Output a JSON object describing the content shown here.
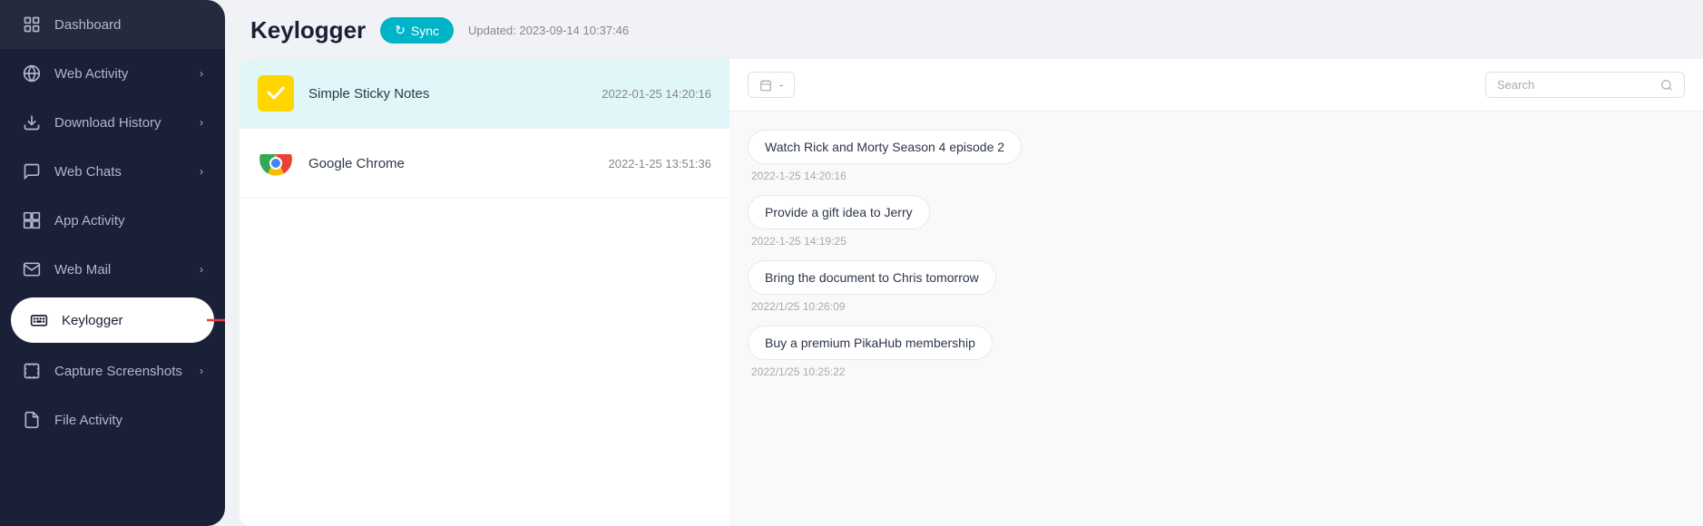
{
  "sidebar": {
    "items": [
      {
        "id": "dashboard",
        "label": "Dashboard",
        "icon": "dashboard",
        "hasChevron": false,
        "active": false
      },
      {
        "id": "web-activity",
        "label": "Web Activity",
        "icon": "globe",
        "hasChevron": true,
        "active": false
      },
      {
        "id": "download-history",
        "label": "Download History",
        "icon": "download",
        "hasChevron": true,
        "active": false
      },
      {
        "id": "web-chats",
        "label": "Web Chats",
        "icon": "chat",
        "hasChevron": true,
        "active": false
      },
      {
        "id": "app-activity",
        "label": "App Activity",
        "icon": "app",
        "hasChevron": false,
        "active": false
      },
      {
        "id": "web-mail",
        "label": "Web Mail",
        "icon": "mail",
        "hasChevron": true,
        "active": false
      },
      {
        "id": "keylogger",
        "label": "Keylogger",
        "icon": "keyboard",
        "hasChevron": false,
        "active": true
      },
      {
        "id": "capture-screenshots",
        "label": "Capture Screenshots",
        "icon": "screenshot",
        "hasChevron": true,
        "active": false
      },
      {
        "id": "file-activity",
        "label": "File Activity",
        "icon": "file",
        "hasChevron": false,
        "active": false
      }
    ]
  },
  "header": {
    "title": "Keylogger",
    "sync_label": "Sync",
    "updated_text": "Updated: 2023-09-14 10:37:46"
  },
  "app_list": {
    "items": [
      {
        "id": "sticky",
        "name": "Simple Sticky Notes",
        "time": "2022-01-25 14:20:16",
        "selected": true,
        "icon_type": "sticky"
      },
      {
        "id": "chrome",
        "name": "Google Chrome",
        "time": "2022-1-25 13:51:36",
        "selected": false,
        "icon_type": "chrome"
      }
    ]
  },
  "notes_panel": {
    "date_selector": "-",
    "search_placeholder": "Search",
    "notes": [
      {
        "text": "Watch Rick and Morty Season 4 episode 2",
        "time": "2022-1-25 14:20:16"
      },
      {
        "text": "Provide a gift idea to Jerry",
        "time": "2022-1-25 14:19:25"
      },
      {
        "text": "Bring the document to Chris tomorrow",
        "time": "2022/1/25 10:26:09"
      },
      {
        "text": "Buy a premium PikaHub membership",
        "time": "2022/1/25 10:25:22"
      }
    ]
  }
}
